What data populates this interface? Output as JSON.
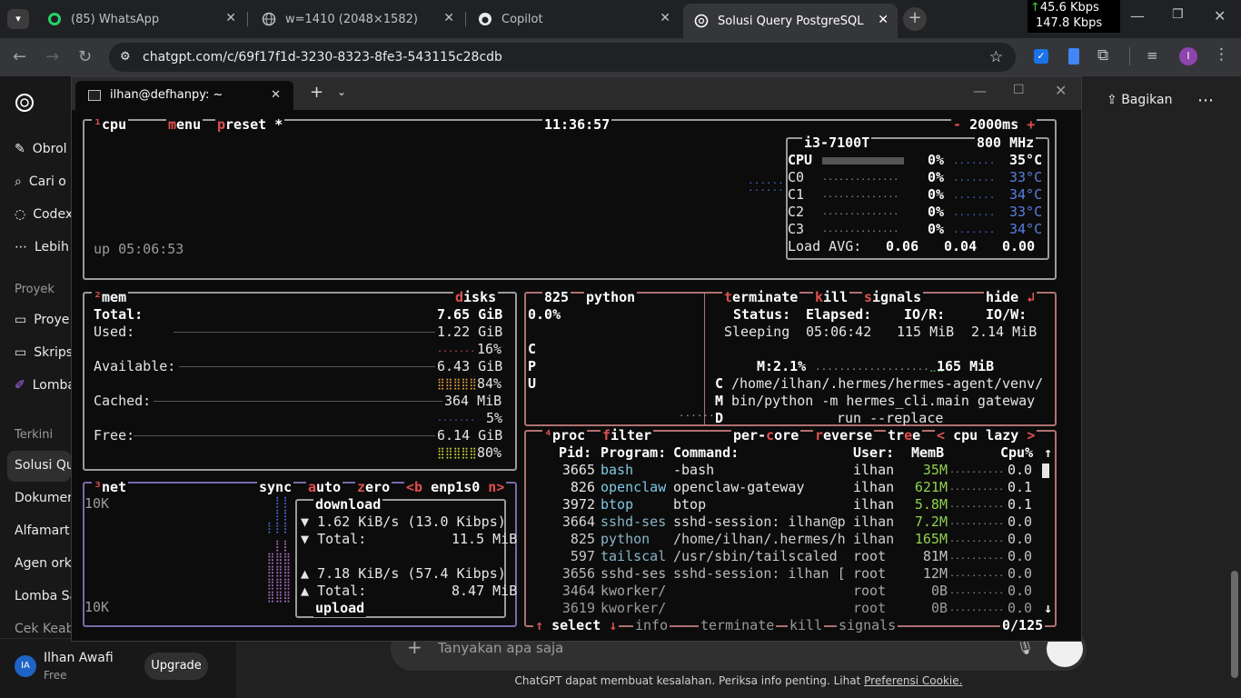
{
  "browser": {
    "tabs": [
      {
        "label": "(85) WhatsApp"
      },
      {
        "label": "w=1410 (2048×1582)"
      },
      {
        "label": "Copilot"
      },
      {
        "label": "Solusi Query PostgreSQL"
      }
    ],
    "net_speed": {
      "up": "45.6 Kbps",
      "down": "147.8 Kbps"
    },
    "url": "chatgpt.com/c/69f17f1d-3230-8323-8fe3-543115c28cdb",
    "profile_initial": "I"
  },
  "chatgpt": {
    "sidebar_items": [
      "Obrol",
      "Cari o",
      "Codex",
      "Lebih"
    ],
    "projects_heading": "Proyek",
    "project_items": [
      "Proye",
      "Skrips",
      "Lomba"
    ],
    "recent_heading": "Terkini",
    "recent_items": [
      "Solusi Que",
      "Dokumen",
      "Alfamart v",
      "Agen orke",
      "Lomba Sa",
      "Cek Keabs"
    ],
    "user_name": "Ilhan Awafi",
    "user_plan": "Free",
    "user_initials": "IA",
    "upgrade_label": "Upgrade",
    "share_label": "Bagikan",
    "composer_placeholder": "Tanyakan apa saja",
    "disclaimer": "ChatGPT dapat membuat kesalahan. Periksa info penting. Lihat",
    "disclaimer_link": "Preferensi Cookie."
  },
  "terminal": {
    "tab_title": "ilhan@defhanpy: ~",
    "cpu_box": {
      "title": "cpu",
      "menu": "menu",
      "preset": "preset *",
      "clock": "11:36:57",
      "interval": "2000ms",
      "uptime": "up 05:06:53",
      "cpu_model": "i3-7100T",
      "freq": "800 MHz",
      "cores": [
        {
          "name": "CPU",
          "pct": "0%",
          "temp": "35°C"
        },
        {
          "name": "C0",
          "pct": "0%",
          "temp": "33°C"
        },
        {
          "name": "C1",
          "pct": "0%",
          "temp": "34°C"
        },
        {
          "name": "C2",
          "pct": "0%",
          "temp": "33°C"
        },
        {
          "name": "C3",
          "pct": "0%",
          "temp": "34°C"
        }
      ],
      "load_label": "Load AVG:",
      "load": [
        "0.06",
        "0.04",
        "0.00"
      ]
    },
    "mem_box": {
      "title": "mem",
      "disks": "disks",
      "rows": [
        {
          "label": "Total:",
          "value": "7.65 GiB"
        },
        {
          "label": "Used:",
          "value": "1.22 GiB",
          "pct": "16%"
        },
        {
          "label": "Available:",
          "value": "6.43 GiB",
          "pct": "84%"
        },
        {
          "label": "Cached:",
          "value": "364 MiB",
          "pct": "5%"
        },
        {
          "label": "Free:",
          "value": "6.14 GiB",
          "pct": "80%"
        }
      ]
    },
    "net_box": {
      "title": "net",
      "sync": "sync",
      "auto": "auto",
      "zero": "zero",
      "iface": "<b enp1s0 n>",
      "scale_top": "10K",
      "scale_bottom": "10K",
      "download": "download",
      "dl_rate": "1.62 KiB/s (13.0 Kibps)",
      "dl_total_label": "Total:",
      "dl_total": "11.5 MiB",
      "ul_rate": "7.18 KiB/s (57.4 Kibps)",
      "ul_total_label": "Total:",
      "ul_total": "8.47 MiB",
      "upload": "upload"
    },
    "detail_box": {
      "pid": "825",
      "name": "python",
      "cpu_pct": "0.0%",
      "terminate": "terminate",
      "kill": "kill",
      "signals": "signals",
      "hide": "hide",
      "status_label": "Status:",
      "status": "Sleeping",
      "elapsed_label": "Elapsed:",
      "elapsed": "05:06:42",
      "ior_label": "IO/R:",
      "ior": "115 MiB",
      "iow_label": "IO/W:",
      "iow": "2.14 MiB",
      "mem_label": "M:2.1%",
      "mem_value": "165 MiB",
      "cmd_lines": [
        "/home/ilhan/.hermes/hermes-agent/venv/",
        "bin/python -m hermes_cli.main gateway",
        "run --replace"
      ]
    },
    "proc_box": {
      "title": "proc",
      "filter": "filter",
      "per_core": "per-core",
      "reverse": "reverse",
      "tree": "tree",
      "sort": "< cpu lazy >",
      "columns": [
        "Pid:",
        "Program:",
        "Command:",
        "User:",
        "MemB",
        "Cpu%"
      ],
      "rows": [
        {
          "pid": "3665",
          "prog": "bash",
          "cmd": "-bash",
          "user": "ilhan",
          "mem": "35M",
          "cpu": "0.0"
        },
        {
          "pid": "826",
          "prog": "openclaw",
          "cmd": "openclaw-gateway",
          "user": "ilhan",
          "mem": "621M",
          "cpu": "0.1"
        },
        {
          "pid": "3972",
          "prog": "btop",
          "cmd": "btop",
          "user": "ilhan",
          "mem": "5.8M",
          "cpu": "0.1"
        },
        {
          "pid": "3664",
          "prog": "sshd-ses",
          "cmd": "sshd-session: ilhan@p",
          "user": "ilhan",
          "mem": "7.2M",
          "cpu": "0.0"
        },
        {
          "pid": "825",
          "prog": "python",
          "cmd": "/home/ilhan/.hermes/h",
          "user": "ilhan",
          "mem": "165M",
          "cpu": "0.0"
        },
        {
          "pid": "597",
          "prog": "tailscal",
          "cmd": "/usr/sbin/tailscaled",
          "user": "root",
          "mem": "81M",
          "cpu": "0.0"
        },
        {
          "pid": "3656",
          "prog": "sshd-ses",
          "cmd": "sshd-session: ilhan [",
          "user": "root",
          "mem": "12M",
          "cpu": "0.0"
        },
        {
          "pid": "3464",
          "prog": "kworker/",
          "cmd": "",
          "user": "root",
          "mem": "0B",
          "cpu": "0.0"
        },
        {
          "pid": "3619",
          "prog": "kworker/",
          "cmd": "",
          "user": "root",
          "mem": "0B",
          "cpu": "0.0"
        }
      ],
      "footer": {
        "select": "select",
        "info": "info",
        "terminate": "terminate",
        "kill": "kill",
        "signals": "signals",
        "count": "0/125"
      }
    }
  }
}
